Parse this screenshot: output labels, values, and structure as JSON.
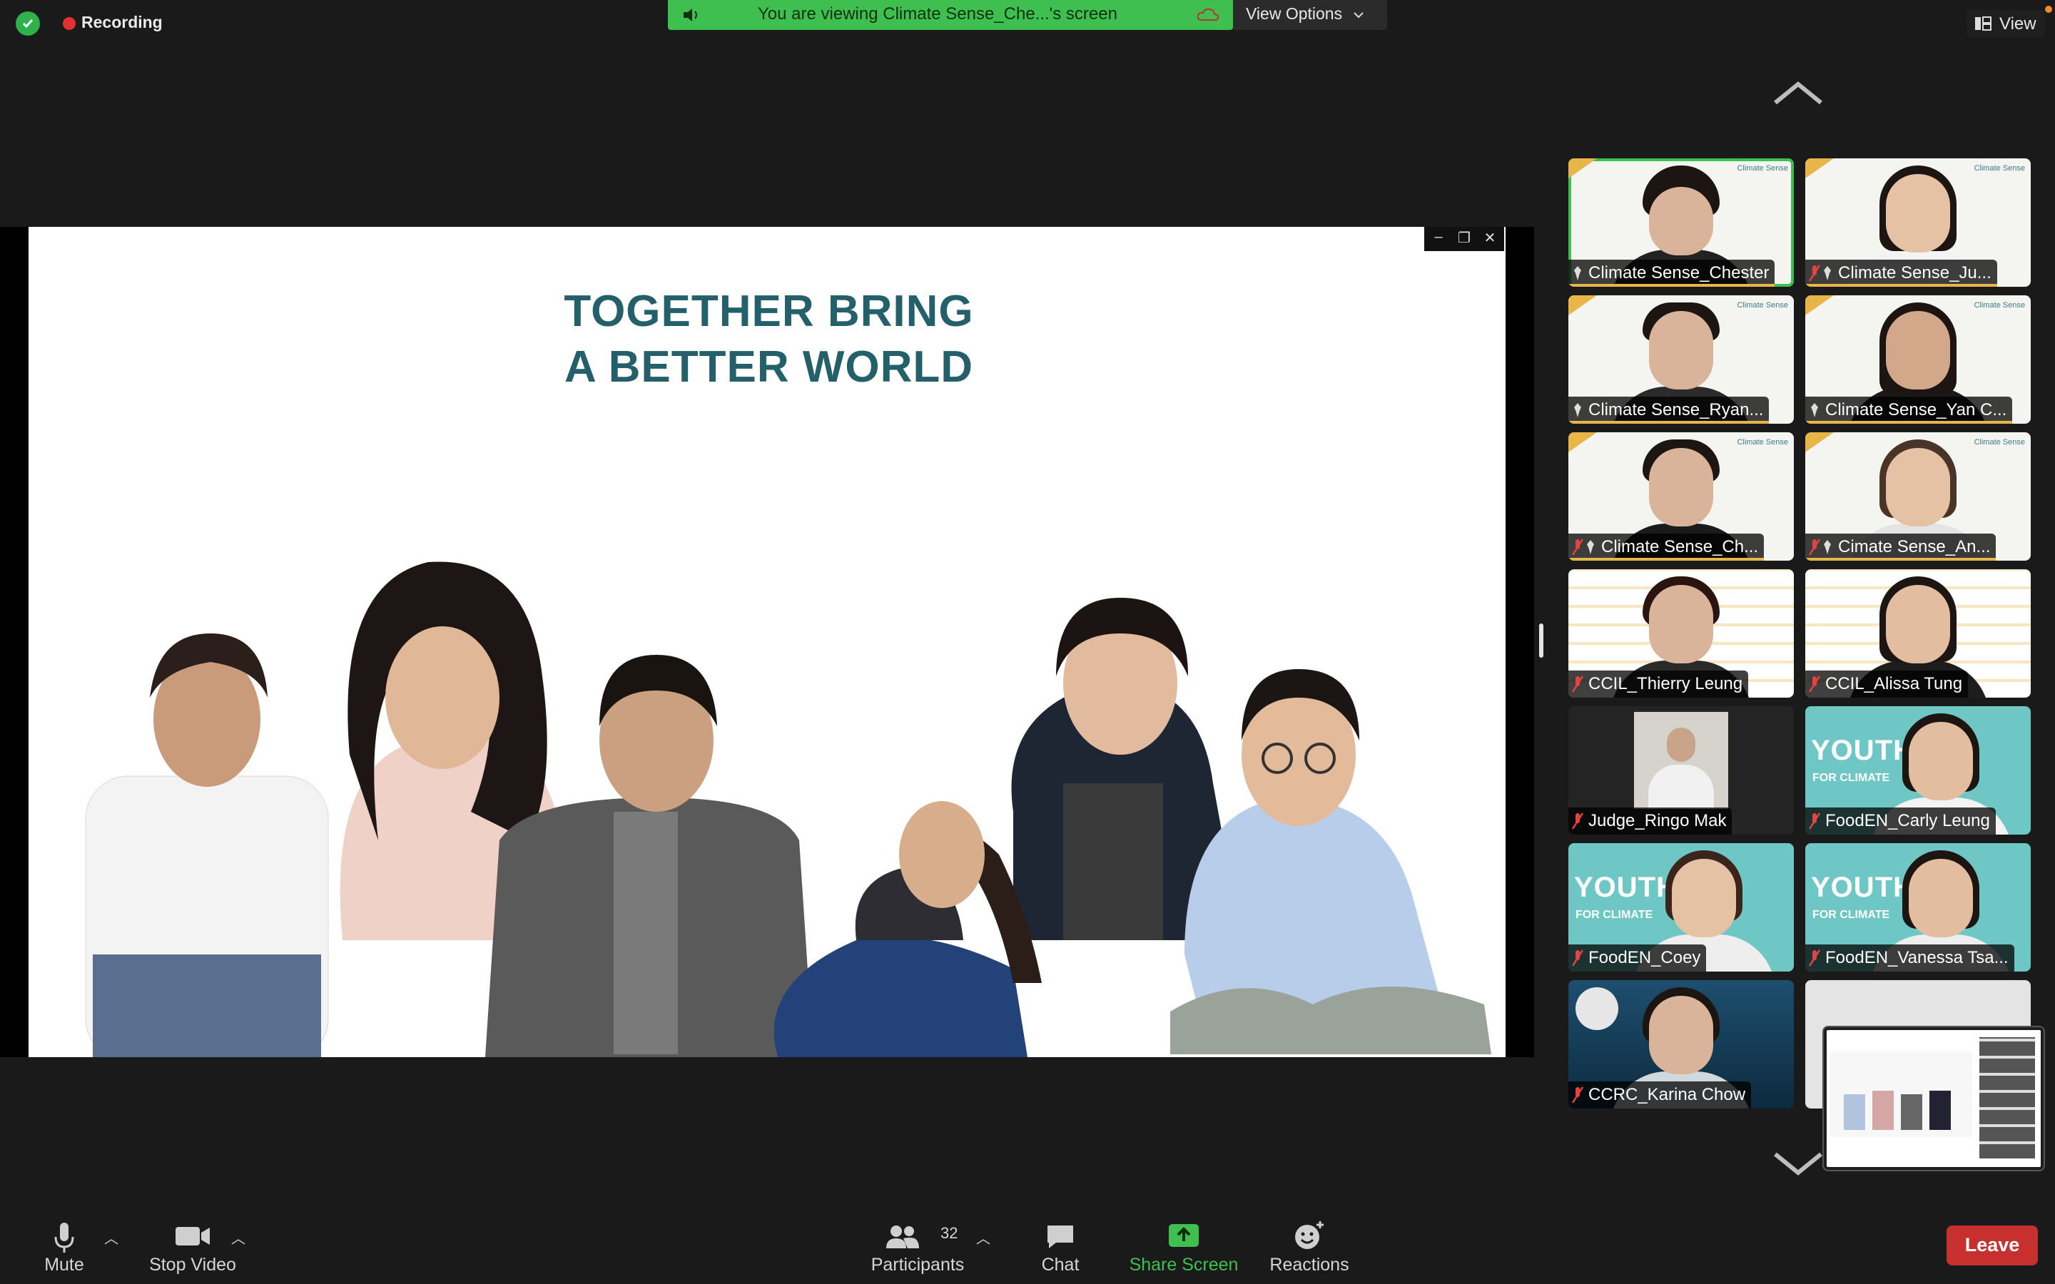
{
  "topbar": {
    "recording_label": "Recording",
    "banner_text": "You are viewing Climate Sense_Che...'s screen",
    "view_options_label": "View Options",
    "view_label": "View"
  },
  "slide": {
    "title_line1": "TOGETHER BRING",
    "title_line2": "A BETTER WORLD"
  },
  "gallery": {
    "tiles": [
      {
        "name": "Climate Sense_Chester"
      },
      {
        "name": "Climate Sense_Ju..."
      },
      {
        "name": "Climate Sense_Ryan..."
      },
      {
        "name": "Climate Sense_Yan C..."
      },
      {
        "name": "Climate Sense_Ch..."
      },
      {
        "name": "Cimate Sense_An..."
      },
      {
        "name": "CCIL_Thierry Leung"
      },
      {
        "name": "CCIL_Alissa Tung"
      },
      {
        "name": "Judge_Ringo Mak"
      },
      {
        "name": "FoodEN_Carly Leung"
      },
      {
        "name": "FoodEN_Coey"
      },
      {
        "name": "FoodEN_Vanessa Tsa..."
      },
      {
        "name": "CCRC_Karina Chow"
      }
    ],
    "badge_text": "Climate Sense",
    "youth_text": "YOUTH",
    "youth_sub": "FOR CLIMATE"
  },
  "toolbar": {
    "mute_label": "Mute",
    "stop_video_label": "Stop Video",
    "participants_label": "Participants",
    "participants_count": "32",
    "chat_label": "Chat",
    "share_screen_label": "Share Screen",
    "reactions_label": "Reactions",
    "leave_label": "Leave"
  },
  "colors": {
    "accent_green": "#3fbf4f",
    "leave_red": "#c83030",
    "slide_title": "#23606a"
  }
}
